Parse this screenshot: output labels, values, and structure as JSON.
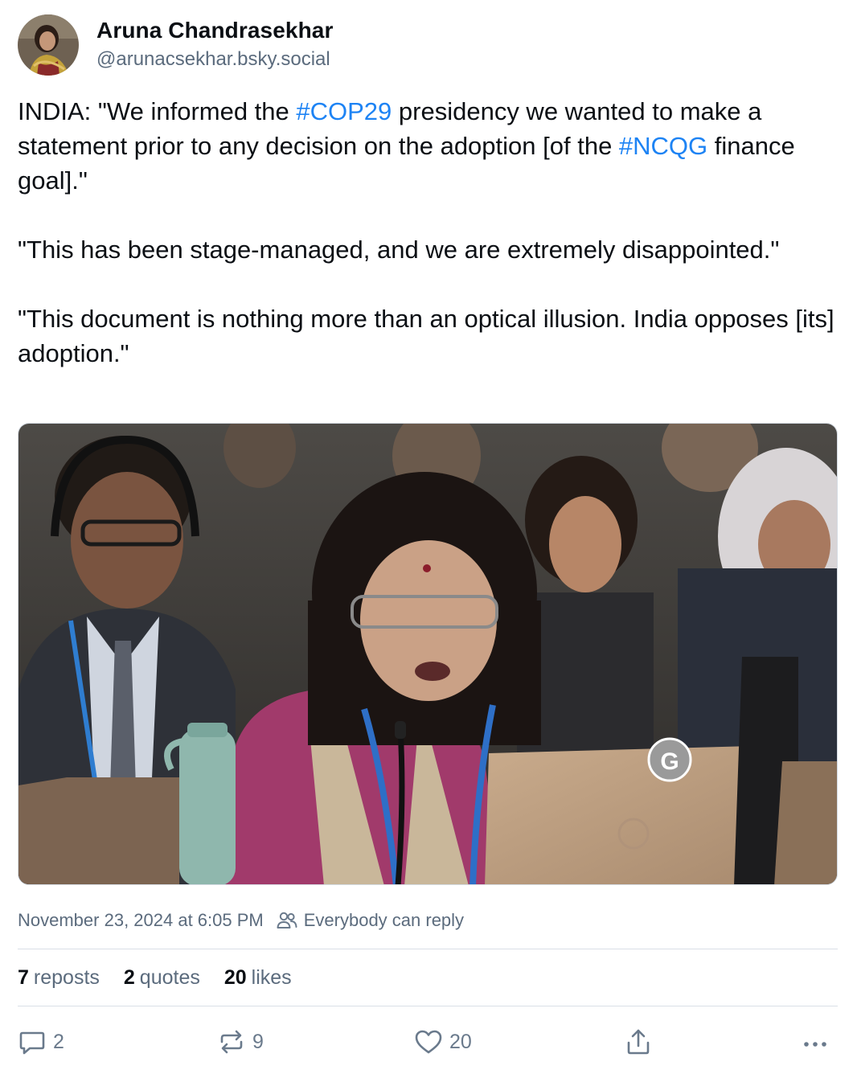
{
  "author": {
    "display_name": "Aruna Chandrasekhar",
    "handle": "@arunacsekhar.bsky.social"
  },
  "post": {
    "paragraph1": {
      "before_tag1": "INDIA: \"We informed the ",
      "tag1": "#COP29",
      "between": " presidency we wanted to make a statement prior to any decision on the adoption [of the ",
      "tag2": "#NCQG",
      "after_tag2": " finance goal].\""
    },
    "paragraph2": "\"This has been stage-managed, and we are extremely disappointed.\"",
    "paragraph3": "\"This document is nothing more than an optical illusion. India opposes [its] adoption.\"",
    "image_overlay_letter": "G"
  },
  "meta": {
    "timestamp": "November 23, 2024 at 6:05 PM",
    "reply_setting": "Everybody can reply"
  },
  "stats": {
    "reposts_count": "7",
    "reposts_label": "reposts",
    "quotes_count": "2",
    "quotes_label": "quotes",
    "likes_count": "20",
    "likes_label": "likes"
  },
  "actions": {
    "reply_count": "2",
    "repost_count": "9",
    "like_count": "20"
  },
  "colors": {
    "link": "#1d83f4",
    "text": "#0b0f14",
    "muted": "#5b6b7d"
  }
}
